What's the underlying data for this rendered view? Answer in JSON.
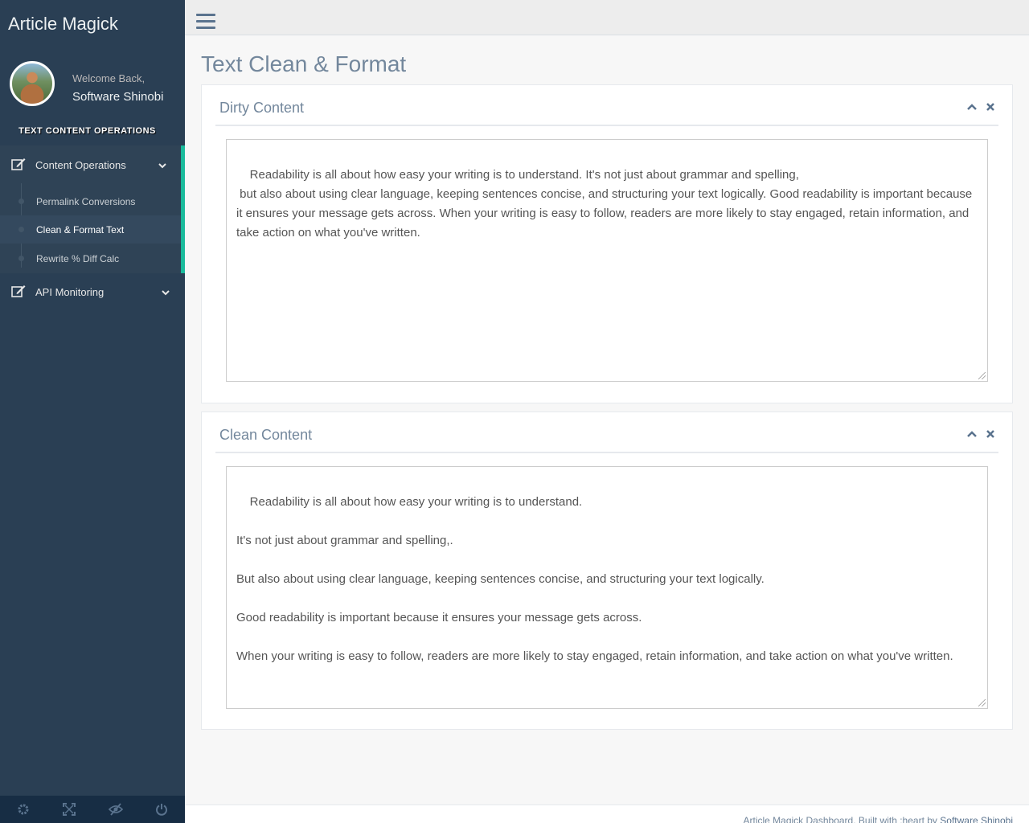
{
  "app": {
    "title": "Article Magick"
  },
  "profile": {
    "welcome": "Welcome Back,",
    "name": "Software Shinobi"
  },
  "sidebar": {
    "section_title": "TEXT CONTENT OPERATIONS",
    "menus": [
      {
        "label": "Content Operations",
        "icon": "edit-icon",
        "expanded": true
      },
      {
        "label": "API Monitoring",
        "icon": "edit-icon",
        "expanded": false
      }
    ],
    "sub_items": [
      {
        "label": "Permalink Conversions"
      },
      {
        "label": "Clean & Format Text",
        "active": true
      },
      {
        "label": "Rewrite % Diff Calc"
      }
    ],
    "footer_icons": [
      "gear-icon",
      "fullscreen-icon",
      "eye-slash-icon",
      "power-icon"
    ]
  },
  "page": {
    "title": "Text Clean & Format"
  },
  "panels": [
    {
      "title": "Dirty Content",
      "content": "Readability is all about how easy your writing is to understand. It's not just about grammar and spelling,\n but also about using clear language, keeping sentences concise, and structuring your text logically. Good readability is important because it ensures your message gets across. When your writing is easy to follow, readers are more likely to stay engaged, retain information, and take action on what you've written."
    },
    {
      "title": "Clean Content",
      "content": "Readability is all about how easy your writing is to understand.\n\nIt's not just about grammar and spelling,.\n\nBut also about using clear language, keeping sentences concise, and structuring your text logically.\n\nGood readability is important because it ensures your message gets across.\n\nWhen your writing is easy to follow, readers are more likely to stay engaged, retain information, and take action on what you've written."
    }
  ],
  "footer": {
    "text": "Article Magick Dashboard. Built with :heart by ",
    "link": "Software Shinobi"
  },
  "colors": {
    "sidebar": "#2a3f54",
    "accent": "#1abb9c",
    "text": "#73879c"
  }
}
